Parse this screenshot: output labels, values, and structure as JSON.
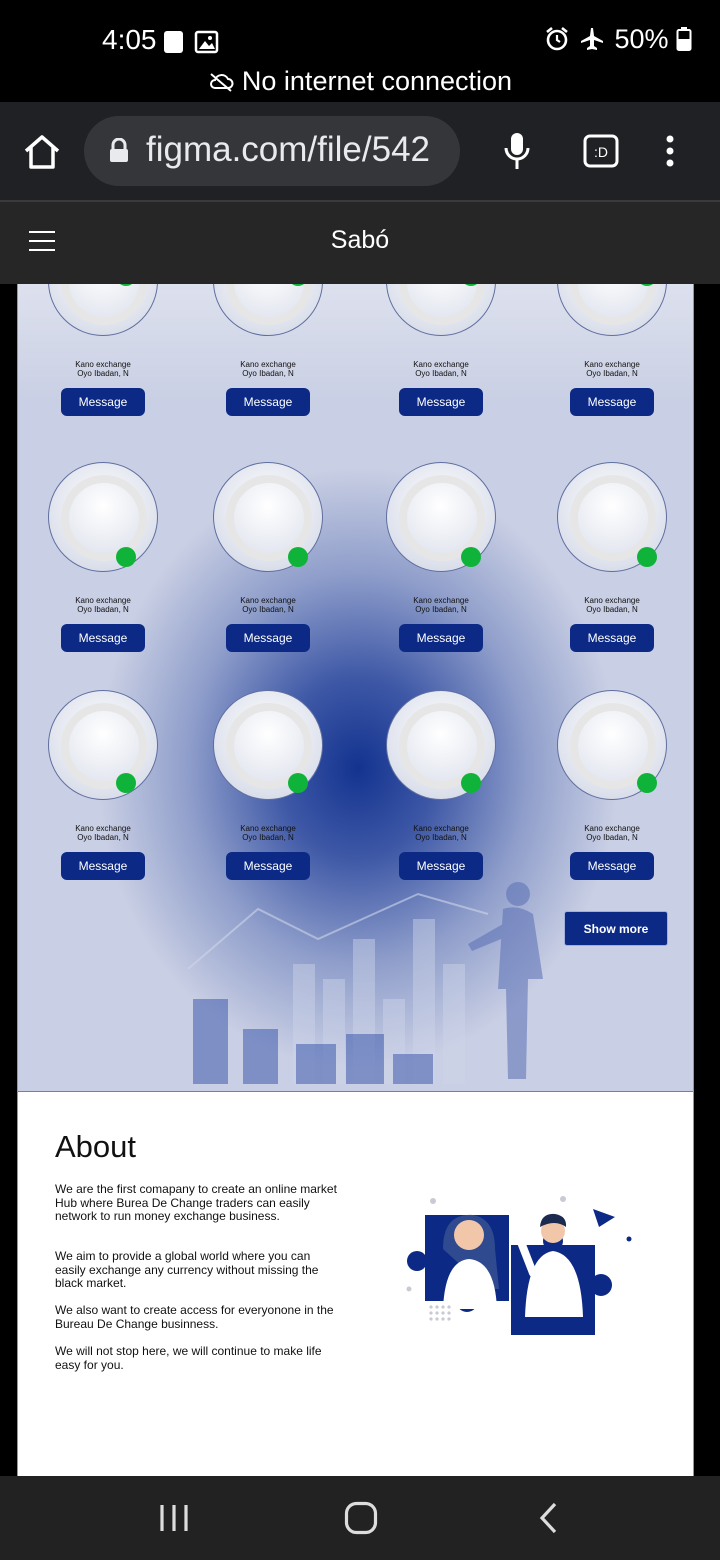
{
  "status_bar": {
    "time": "4:05",
    "battery": "50%",
    "network_message": "No internet connection"
  },
  "browser": {
    "url": "figma.com/file/542"
  },
  "site": {
    "title": "Sabó"
  },
  "cards": [
    {
      "line1": "Kano exchange",
      "line2": "Oyo Ibadan, N",
      "button": "Message"
    },
    {
      "line1": "Kano exchange",
      "line2": "Oyo Ibadan, N",
      "button": "Message"
    },
    {
      "line1": "Kano exchange",
      "line2": "Oyo Ibadan, N",
      "button": "Message"
    },
    {
      "line1": "Kano exchange",
      "line2": "Oyo Ibadan, N",
      "button": "Message"
    },
    {
      "line1": "Kano exchange",
      "line2": "Oyo Ibadan, N",
      "button": "Message"
    },
    {
      "line1": "Kano exchange",
      "line2": "Oyo Ibadan, N",
      "button": "Message"
    },
    {
      "line1": "Kano exchange",
      "line2": "Oyo Ibadan, N",
      "button": "Message"
    },
    {
      "line1": "Kano exchange",
      "line2": "Oyo Ibadan, N",
      "button": "Message"
    },
    {
      "line1": "Kano exchange",
      "line2": "Oyo Ibadan, N",
      "button": "Message"
    },
    {
      "line1": "Kano exchange",
      "line2": "Oyo Ibadan, N",
      "button": "Message"
    },
    {
      "line1": "Kano exchange",
      "line2": "Oyo Ibadan, N",
      "button": "Message"
    },
    {
      "line1": "Kano exchange",
      "line2": "Oyo Ibadan, N",
      "button": "Message"
    }
  ],
  "show_more_label": "Show more",
  "about": {
    "title": "About",
    "paragraphs": [
      "We are the first comapany to create an online market Hub where Burea De Change traders can easily network to run money exchange business.",
      "We aim to provide a global world where you can easily exchange any currency without missing the black market.",
      "We also want to create access for everyonone in the Bureau De Change businness.",
      "We will not stop here, we will continue to make life\neasy for you."
    ]
  },
  "colors": {
    "brand_navy": "#0c2a85",
    "online_green": "#10b33a"
  }
}
